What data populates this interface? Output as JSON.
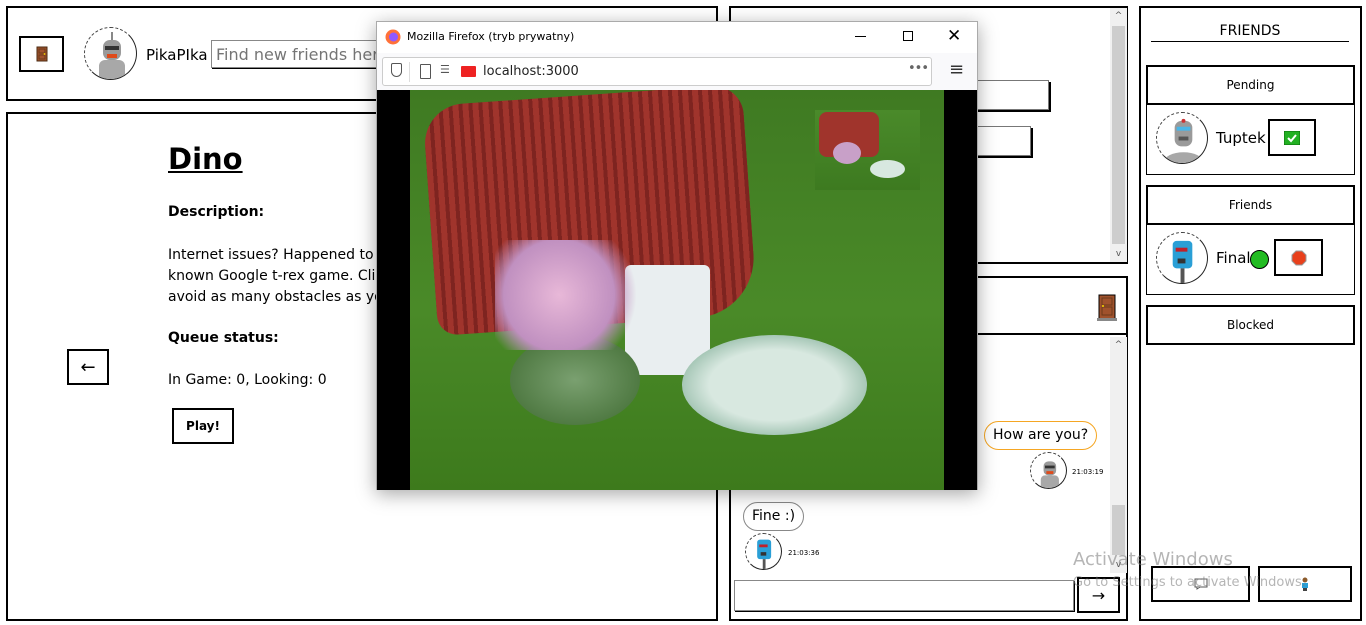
{
  "header": {
    "username": "PikaPIka",
    "search_placeholder": "Find new friends here..."
  },
  "game": {
    "title": "Dino",
    "description_label": "Description:",
    "description_lines": [
      "Internet issues? Happened to",
      "known Google t-rex game. Cli",
      "avoid as many obstacles as yo"
    ],
    "queue_label": "Queue status:",
    "queue_status": "In Game: 0, Looking: 0",
    "play_label": "Play!",
    "back_label": "←"
  },
  "chat": {
    "messages": [
      {
        "text": "How are you?",
        "time": "21:03:19",
        "side": "right",
        "border": "#f5a623"
      },
      {
        "text": "Fine :)",
        "time": "21:03:36",
        "side": "left",
        "border": "#888888"
      }
    ],
    "input_value": "",
    "send_label": "→"
  },
  "friends": {
    "title": "FRIENDS",
    "pending_label": "Pending",
    "pending": [
      {
        "name": "Tuptek",
        "action": "accept-icon"
      }
    ],
    "friends_label": "Friends",
    "friends": [
      {
        "name": "Final",
        "online": true,
        "status_color": "#22bb22",
        "action": "block-icon"
      }
    ],
    "blocked_label": "Blocked"
  },
  "firefox": {
    "title": "Mozilla Firefox (tryb prywatny)",
    "url": "localhost:3000"
  },
  "watermark": {
    "line1": "Activate Windows",
    "line2": "Go to Settings to activate Windows."
  }
}
